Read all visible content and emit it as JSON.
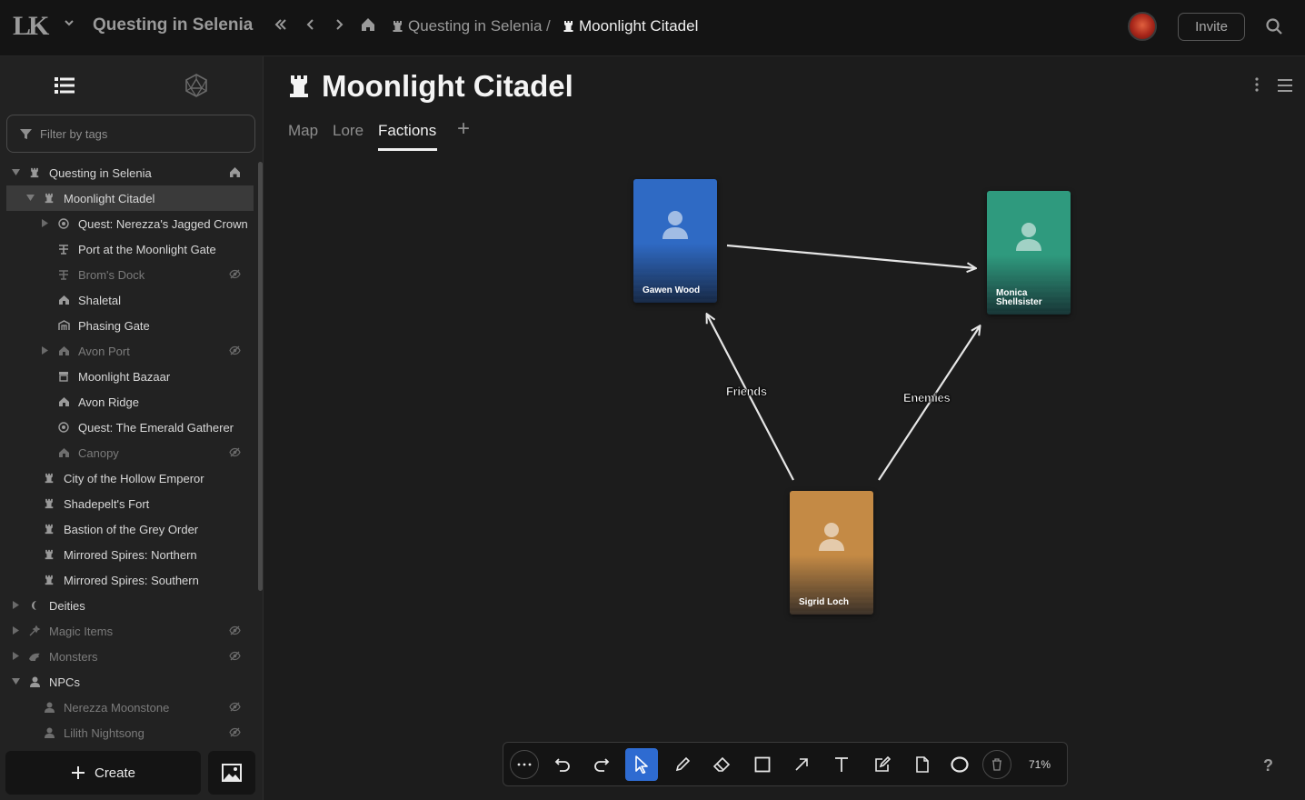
{
  "topbar": {
    "logo_text": "LK",
    "app_title": "Questing in Selenia",
    "breadcrumbs": [
      "Questing in Selenia",
      "Moonlight Citadel"
    ],
    "breadcrumb_separator": "/",
    "invite_label": "Invite"
  },
  "sidebar": {
    "filter_placeholder": "Filter by tags",
    "items": [
      {
        "label": "Questing in Selenia",
        "icon": "tower-icon",
        "depth": 0,
        "caret": "down",
        "home": true
      },
      {
        "label": "Moonlight Citadel",
        "icon": "tower-icon",
        "depth": 1,
        "caret": "down",
        "selected": true
      },
      {
        "label": "Quest: Nerezza's Jagged Crown",
        "icon": "quest-icon",
        "depth": 2,
        "caret": "right"
      },
      {
        "label": "Port at the Moonlight Gate",
        "icon": "port-icon",
        "depth": 2
      },
      {
        "label": "Brom's Dock",
        "icon": "port-icon",
        "depth": 2,
        "hidden": true
      },
      {
        "label": "Shaletal",
        "icon": "village-icon",
        "depth": 2
      },
      {
        "label": "Phasing Gate",
        "icon": "gate-icon",
        "depth": 2
      },
      {
        "label": "Avon Port",
        "icon": "village-icon",
        "depth": 2,
        "caret": "right",
        "hidden": true
      },
      {
        "label": "Moonlight Bazaar",
        "icon": "shop-icon",
        "depth": 2
      },
      {
        "label": "Avon Ridge",
        "icon": "village-icon",
        "depth": 2
      },
      {
        "label": "Quest: The Emerald Gatherer",
        "icon": "quest-icon",
        "depth": 2
      },
      {
        "label": "Canopy",
        "icon": "village-icon",
        "depth": 2,
        "hidden": true
      },
      {
        "label": "City of the Hollow Emperor",
        "icon": "tower-icon",
        "depth": 1
      },
      {
        "label": "Shadepelt's Fort",
        "icon": "tower-icon",
        "depth": 1
      },
      {
        "label": "Bastion of the Grey Order",
        "icon": "tower-icon",
        "depth": 1
      },
      {
        "label": "Mirrored Spires: Northern",
        "icon": "tower-icon",
        "depth": 1
      },
      {
        "label": "Mirrored Spires: Southern",
        "icon": "tower-icon",
        "depth": 1
      },
      {
        "label": "Deities",
        "icon": "moon-icon",
        "depth": 0,
        "caret": "right"
      },
      {
        "label": "Magic Items",
        "icon": "magic-icon",
        "depth": 0,
        "caret": "right",
        "hidden": true
      },
      {
        "label": "Monsters",
        "icon": "monster-icon",
        "depth": 0,
        "caret": "right",
        "hidden": true
      },
      {
        "label": "NPCs",
        "icon": "person-icon",
        "depth": 0,
        "caret": "down"
      },
      {
        "label": "Nerezza Moonstone",
        "icon": "person-icon",
        "depth": 1,
        "hidden": true
      },
      {
        "label": "Lilith Nightsong",
        "icon": "person-icon",
        "depth": 1,
        "hidden": true
      }
    ],
    "create_label": "Create"
  },
  "page": {
    "title": "Moonlight Citadel",
    "tabs": [
      "Map",
      "Lore",
      "Factions"
    ],
    "active_tab": "Factions"
  },
  "canvas": {
    "cards": [
      {
        "id": "gawen",
        "name": "Gawen Wood",
        "color": "#2f6ac4"
      },
      {
        "id": "monica",
        "name": "Monica Shellsister",
        "color": "#2f9a7e"
      },
      {
        "id": "sigrid",
        "name": "Sigrid Loch",
        "color": "#c48a45"
      }
    ],
    "edges": [
      {
        "from": "gawen",
        "to": "monica",
        "label": ""
      },
      {
        "from": "sigrid",
        "to": "gawen",
        "label": "Friends"
      },
      {
        "from": "sigrid",
        "to": "monica",
        "label": "Enemies"
      }
    ]
  },
  "toolbar": {
    "tools": [
      "more-icon",
      "undo-icon",
      "redo-icon",
      "select-cursor-icon",
      "pencil-icon",
      "eraser-icon",
      "rectangle-icon",
      "arrow-icon",
      "text-icon",
      "note-icon",
      "page-icon",
      "ellipse-icon",
      "trash-icon"
    ],
    "active_tool": "select-cursor-icon",
    "zoom": "71%"
  },
  "help_label": "?"
}
